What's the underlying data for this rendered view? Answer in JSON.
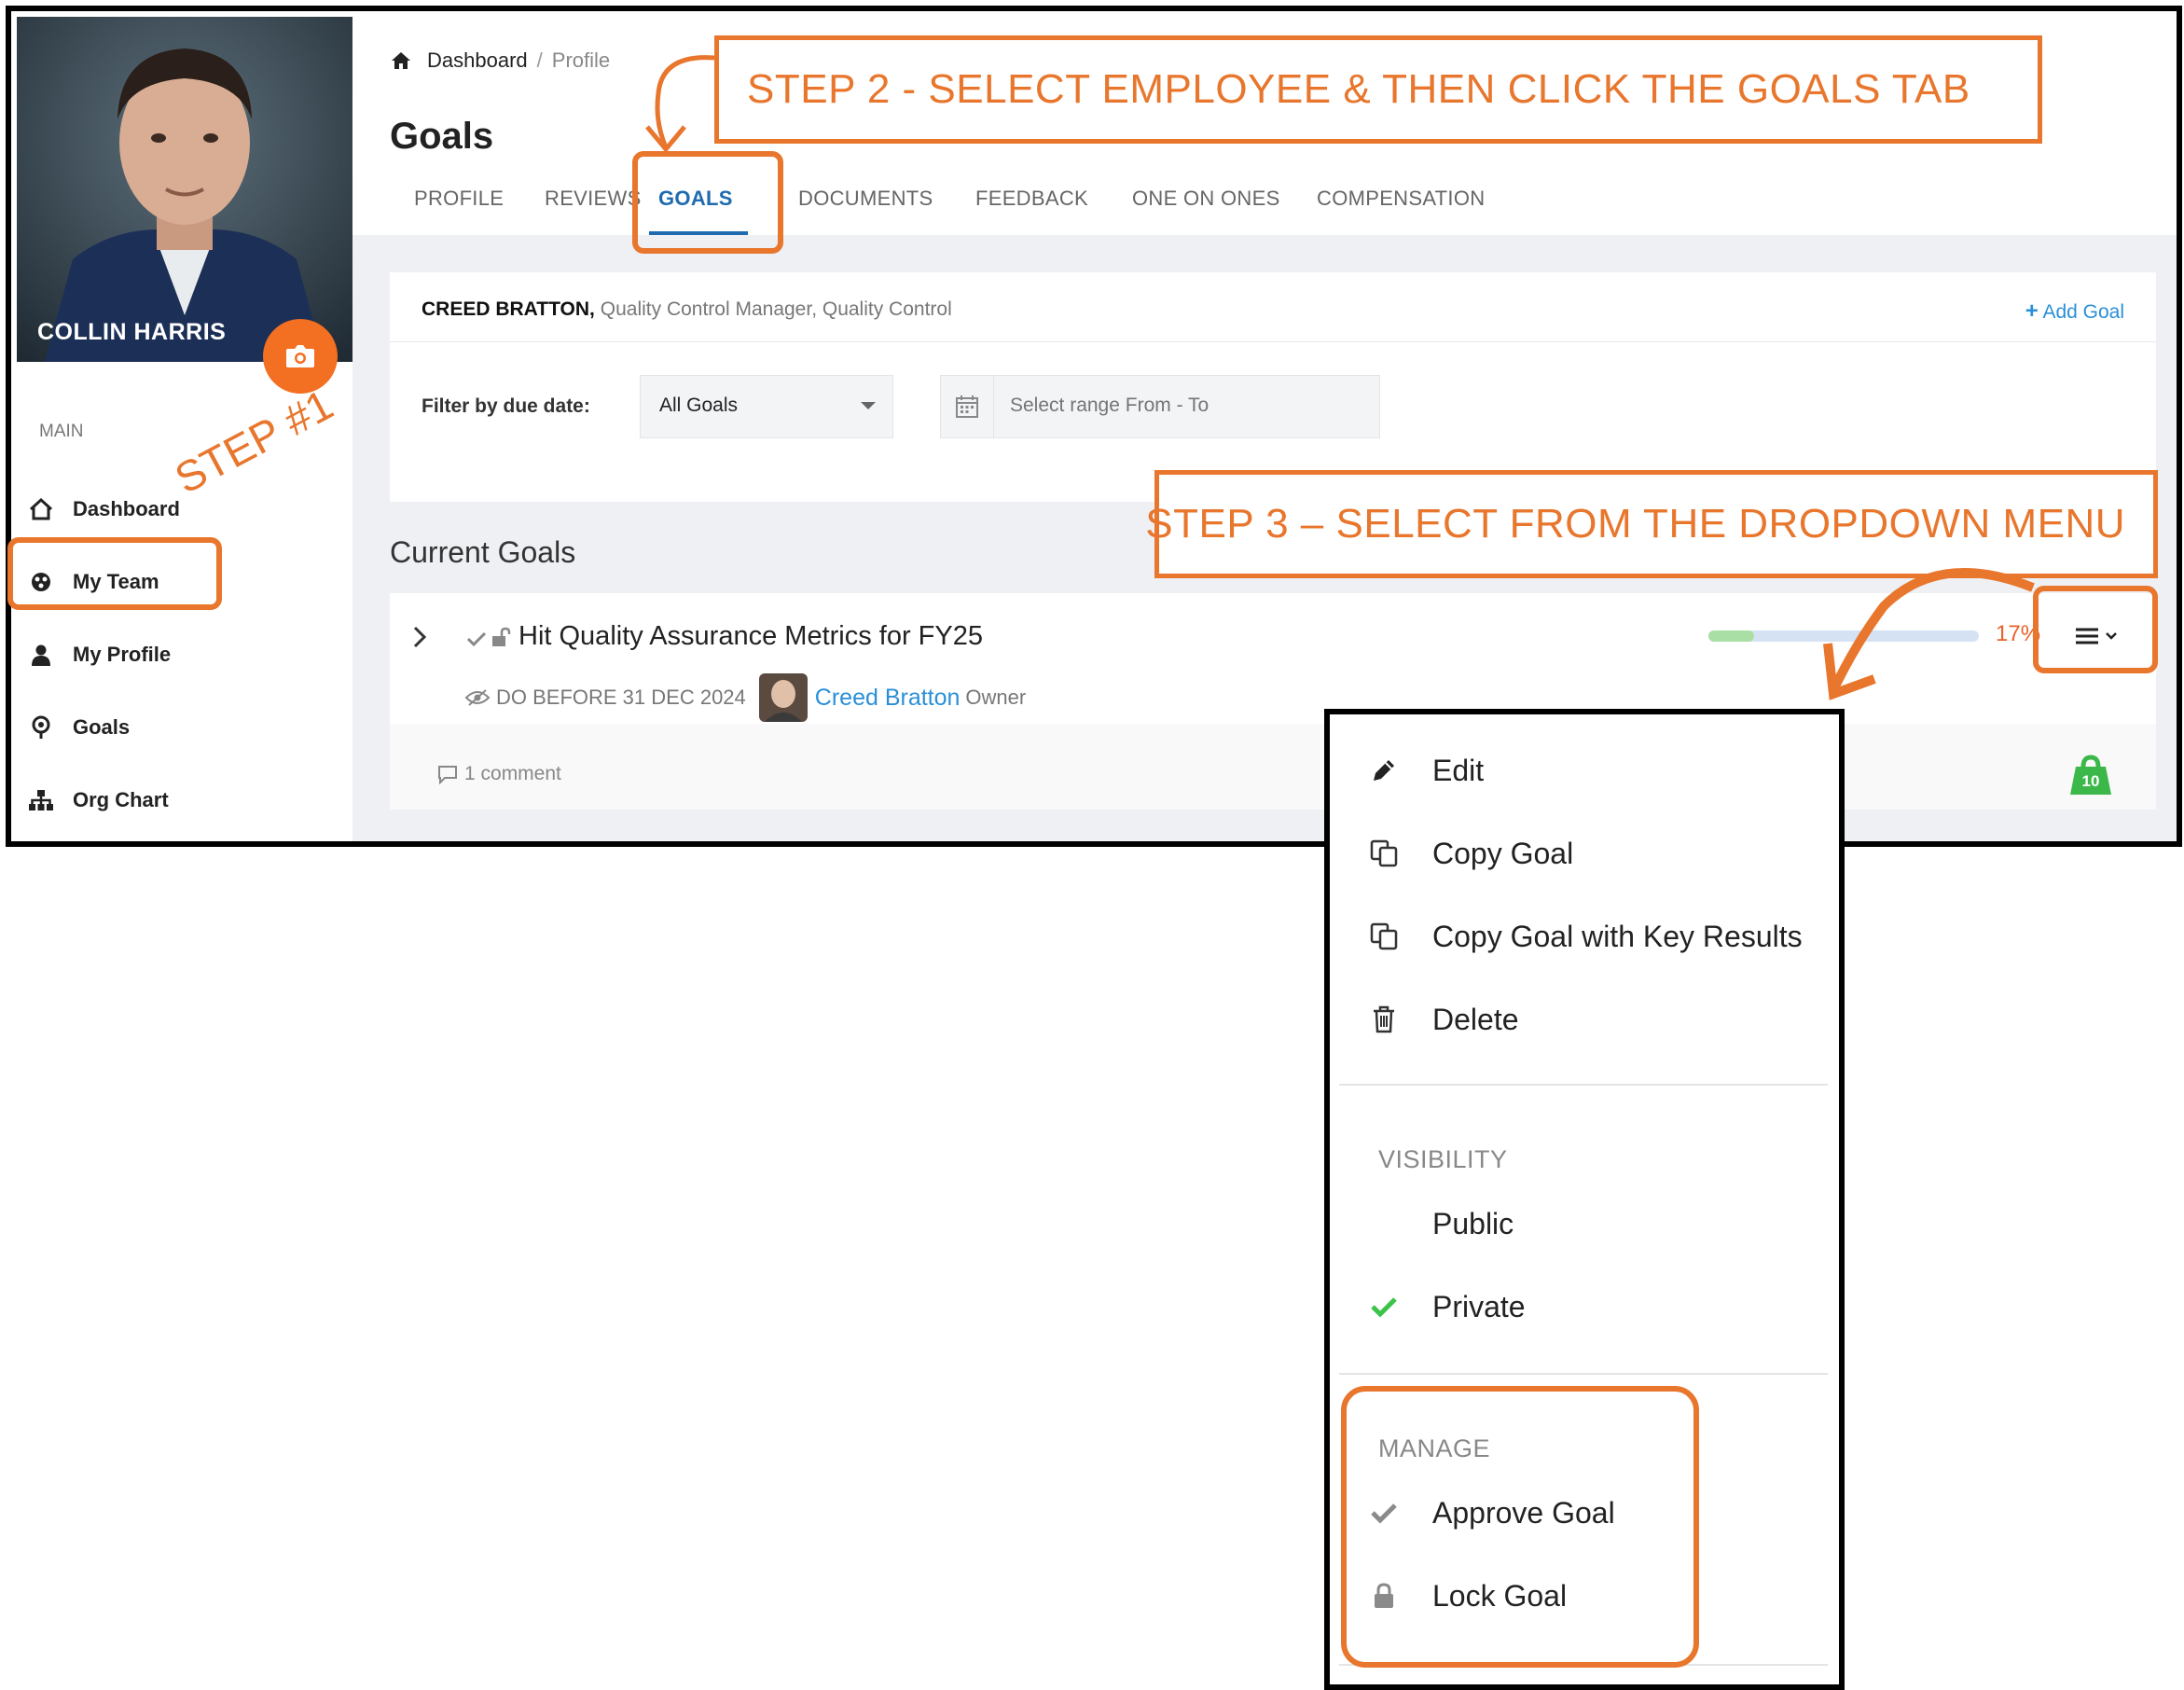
{
  "sidebar": {
    "user_name": "COLLIN HARRIS",
    "section_label": "MAIN",
    "items": [
      {
        "label": "Dashboard",
        "icon": "home-icon"
      },
      {
        "label": "My Team",
        "icon": "team-icon"
      },
      {
        "label": "My Profile",
        "icon": "user-icon"
      },
      {
        "label": "Goals",
        "icon": "goals-icon"
      },
      {
        "label": "Org Chart",
        "icon": "org-chart-icon"
      }
    ]
  },
  "breadcrumb": {
    "home": "Dashboard",
    "separator": "/",
    "current": "Profile"
  },
  "page_title": "Goals",
  "tabs": [
    {
      "label": "PROFILE"
    },
    {
      "label": "REVIEWS"
    },
    {
      "label": "GOALS",
      "active": true
    },
    {
      "label": "DOCUMENTS"
    },
    {
      "label": "FEEDBACK"
    },
    {
      "label": "ONE ON ONES"
    },
    {
      "label": "COMPENSATION"
    }
  ],
  "employee": {
    "name": "CREED BRATTON,",
    "details": "Quality Control Manager, Quality Control"
  },
  "add_goal_label": "Add Goal",
  "filter": {
    "label": "Filter by due date:",
    "selected": "All Goals",
    "range_placeholder": "Select range From - To"
  },
  "current_goals_heading": "Current Goals",
  "goal": {
    "title": "Hit Quality Assurance Metrics for FY25",
    "due": "DO BEFORE 31 DEC 2024",
    "owner_name": "Creed Bratton",
    "owner_role": "Owner",
    "progress": 0.17,
    "progress_label": "17%",
    "comments": "1 comment",
    "weight": "10"
  },
  "dropdown": {
    "actions": [
      {
        "label": "Edit",
        "icon": "pencil-icon"
      },
      {
        "label": "Copy Goal",
        "icon": "copy-icon"
      },
      {
        "label": "Copy Goal with Key Results",
        "icon": "copy-icon"
      },
      {
        "label": "Delete",
        "icon": "trash-icon"
      }
    ],
    "visibility_header": "VISIBILITY",
    "visibility": [
      {
        "label": "Public",
        "checked": false
      },
      {
        "label": "Private",
        "checked": true
      }
    ],
    "manage_header": "MANAGE",
    "manage": [
      {
        "label": "Approve Goal",
        "icon": "check-icon"
      },
      {
        "label": "Lock Goal",
        "icon": "lock-icon"
      }
    ]
  },
  "annotations": {
    "step1": "STEP #1",
    "step2": "STEP 2 - SELECT EMPLOYEE & THEN CLICK THE GOALS TAB",
    "step3": "STEP 3 – SELECT FROM THE DROPDOWN MENU"
  },
  "colors": {
    "accent": "#e8762d",
    "link": "#2a8fd8",
    "active_tab": "#1f6bb0",
    "progress": "#a9dfa5",
    "camera": "#f36f21"
  }
}
